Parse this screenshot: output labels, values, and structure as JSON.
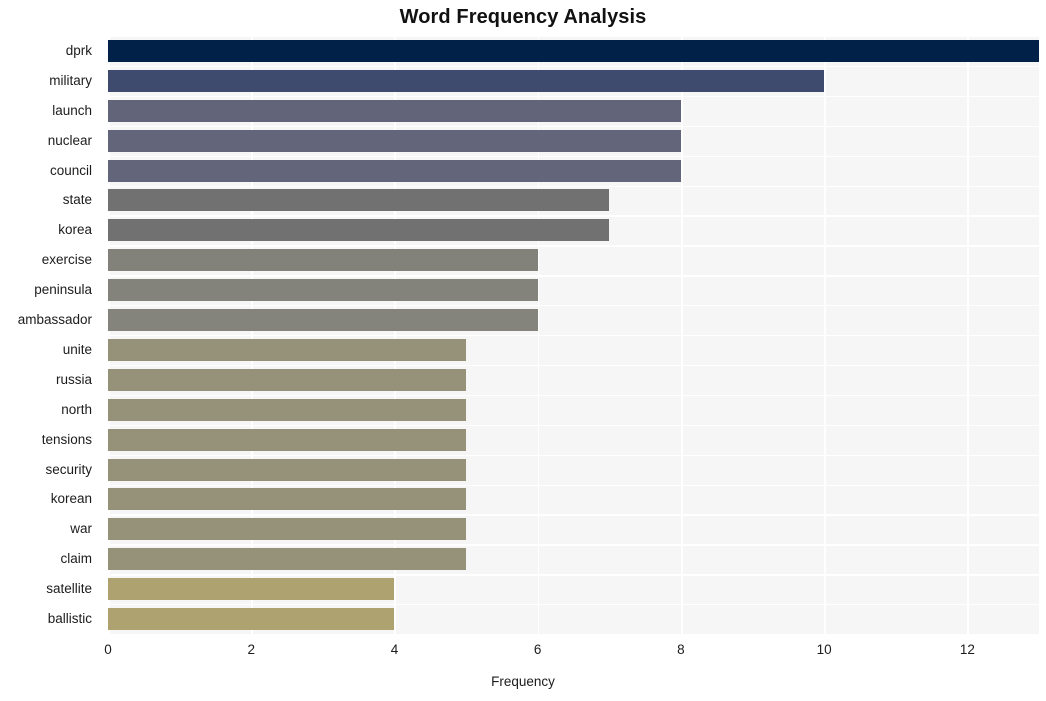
{
  "chart_data": {
    "type": "bar",
    "orientation": "horizontal",
    "title": "Word Frequency Analysis",
    "xlabel": "Frequency",
    "ylabel": "",
    "xlim": [
      0,
      13.0
    ],
    "ylim": null,
    "grid": true,
    "legend": null,
    "xticks": [
      0,
      2,
      4,
      6,
      8,
      10,
      12
    ],
    "categories": [
      "dprk",
      "military",
      "launch",
      "nuclear",
      "council",
      "state",
      "korea",
      "exercise",
      "peninsula",
      "ambassador",
      "unite",
      "russia",
      "north",
      "tensions",
      "security",
      "korean",
      "war",
      "claim",
      "satellite",
      "ballistic"
    ],
    "values": [
      13,
      10,
      8,
      8,
      8,
      7,
      7,
      6,
      6,
      6,
      5,
      5,
      5,
      5,
      5,
      5,
      5,
      5,
      4,
      4
    ],
    "bar_colors": [
      "#012149",
      "#3e4a6e",
      "#62657a",
      "#63667b",
      "#63667b",
      "#717171",
      "#717171",
      "#83827a",
      "#84837b",
      "#85847c",
      "#969279",
      "#969279",
      "#969279",
      "#969279",
      "#969279",
      "#969279",
      "#969279",
      "#969279",
      "#aea271",
      "#aea271"
    ],
    "plot_background": "#f6f6f6",
    "gridline_color": "#ffffff",
    "figure_background": "#ffffff"
  }
}
